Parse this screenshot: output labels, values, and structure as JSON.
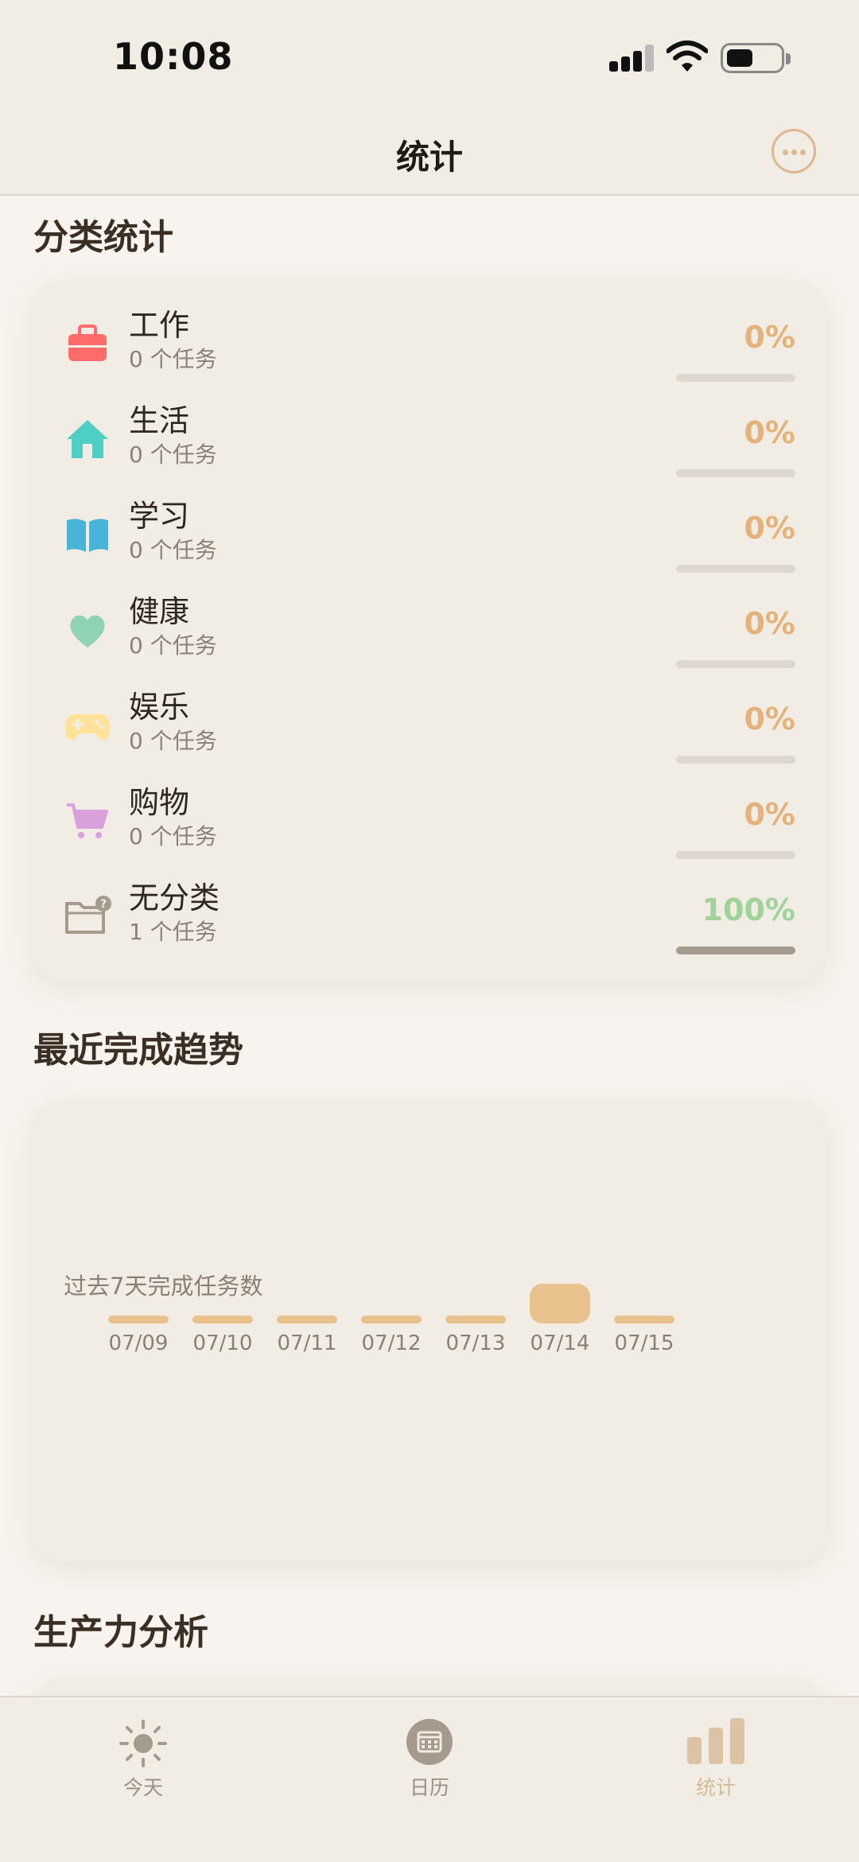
{
  "status": {
    "time": "10:08"
  },
  "nav": {
    "title": "统计"
  },
  "categories_section": {
    "title": "分类统计"
  },
  "categories": [
    {
      "name": "工作",
      "count": "0 个任务",
      "percent": "0%",
      "progress": 0,
      "icon": "briefcase-icon",
      "icon_color": "#ff6b6b",
      "percent_color": "#e4b27a"
    },
    {
      "name": "生活",
      "count": "0 个任务",
      "percent": "0%",
      "progress": 0,
      "icon": "house-icon",
      "icon_color": "#4fcfc3",
      "percent_color": "#e4b27a"
    },
    {
      "name": "学习",
      "count": "0 个任务",
      "percent": "0%",
      "progress": 0,
      "icon": "book-icon",
      "icon_color": "#49b4d8",
      "percent_color": "#e4b27a"
    },
    {
      "name": "健康",
      "count": "0 个任务",
      "percent": "0%",
      "progress": 0,
      "icon": "heart-icon",
      "icon_color": "#8fd3b3",
      "percent_color": "#e4b27a"
    },
    {
      "name": "娱乐",
      "count": "0 个任务",
      "percent": "0%",
      "progress": 0,
      "icon": "gamepad-icon",
      "icon_color": "#ffe29a",
      "percent_color": "#e4b27a"
    },
    {
      "name": "购物",
      "count": "0 个任务",
      "percent": "0%",
      "progress": 0,
      "icon": "cart-icon",
      "icon_color": "#d9a0dc",
      "percent_color": "#e4b27a"
    },
    {
      "name": "无分类",
      "count": "1 个任务",
      "percent": "100%",
      "progress": 1,
      "icon": "folder-question-icon",
      "icon_color": "#a69a8c",
      "percent_color": "#9fd39a"
    }
  ],
  "trend_section": {
    "title": "最近完成趋势",
    "subtitle": "过去7天完成任务数"
  },
  "trend": {
    "days": [
      "07/09",
      "07/10",
      "07/11",
      "07/12",
      "07/13",
      "07/14",
      "07/15"
    ],
    "values": [
      0,
      0,
      0,
      0,
      0,
      1,
      0
    ],
    "bar_color": "#e8c18c"
  },
  "productivity_section": {
    "title": "生产力分析"
  },
  "tabs": [
    {
      "label": "今天",
      "icon": "sun-icon"
    },
    {
      "label": "日历",
      "icon": "calendar-icon"
    },
    {
      "label": "统计",
      "icon": "bar-chart-icon",
      "active": true
    }
  ]
}
